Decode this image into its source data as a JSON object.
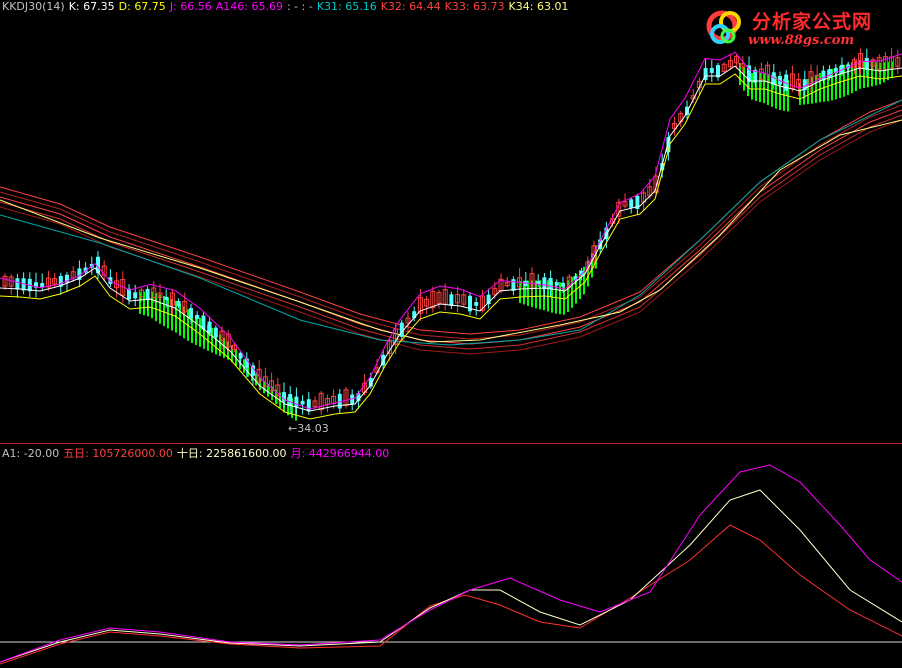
{
  "header_top": [
    {
      "text": "KKDJ30(14)",
      "color": "#c0c0c0"
    },
    {
      "text": "K: 67.35",
      "color": "#ffffff"
    },
    {
      "text": "D: 67.75",
      "color": "#ffff00"
    },
    {
      "text": "J: 66.56",
      "color": "#ff00ff"
    },
    {
      "text": "A146: 65.69",
      "color": "#ff00ff"
    },
    {
      "text": ": - : -",
      "color": "#c0c0c0"
    },
    {
      "text": "K31: 65.16",
      "color": "#00c8c8"
    },
    {
      "text": "K32: 64.44",
      "color": "#ff4040"
    },
    {
      "text": "K33: 63.73",
      "color": "#ff4040"
    },
    {
      "text": "K34: 63.01",
      "color": "#ffff80"
    }
  ],
  "header_bottom": [
    {
      "text": "A1: -20.00",
      "color": "#c0c0c0"
    },
    {
      "text": "五日: 105726000.00",
      "color": "#ff4040"
    },
    {
      "text": "十日: 225861600.00",
      "color": "#ffffcc"
    },
    {
      "text": "月: 442966944.00",
      "color": "#ff00ff"
    }
  ],
  "logo": {
    "name": "分析家公式网",
    "url": "www.88gs.com"
  },
  "annotation_low": "←34.03",
  "colors": {
    "background": "#000000",
    "up_candle": "#ff4040",
    "down_candle": "#54ffff",
    "divider": "#c02020",
    "fill_band": "#00ff00"
  },
  "chart_data": [
    {
      "type": "candlestick",
      "panel": "price",
      "y_range_approx": [
        28,
        75
      ],
      "low_annotation": 34.03,
      "series": [
        {
          "name": "K",
          "color": "#ffffff",
          "last": 67.35
        },
        {
          "name": "D",
          "color": "#ffff00",
          "last": 67.75
        },
        {
          "name": "J",
          "color": "#ff00ff",
          "last": 66.56
        },
        {
          "name": "A146",
          "color": "#ff00ff",
          "last": 65.69
        },
        {
          "name": "K31",
          "color": "#00c8c8",
          "last": 65.16
        },
        {
          "name": "K32",
          "color": "#ff4040",
          "last": 64.44
        },
        {
          "name": "K33",
          "color": "#ff4040",
          "last": 63.73
        },
        {
          "name": "K34",
          "color": "#ffff80",
          "last": 63.01
        }
      ]
    },
    {
      "type": "line",
      "panel": "volume_ma",
      "baseline": {
        "name": "A1",
        "value": -20.0
      },
      "series": [
        {
          "name": "五日",
          "color": "#ff4040",
          "last": 105726000.0
        },
        {
          "name": "十日",
          "color": "#ffffcc",
          "last": 225861600.0
        },
        {
          "name": "月",
          "color": "#ff00ff",
          "last": 442966944.0
        }
      ]
    }
  ]
}
